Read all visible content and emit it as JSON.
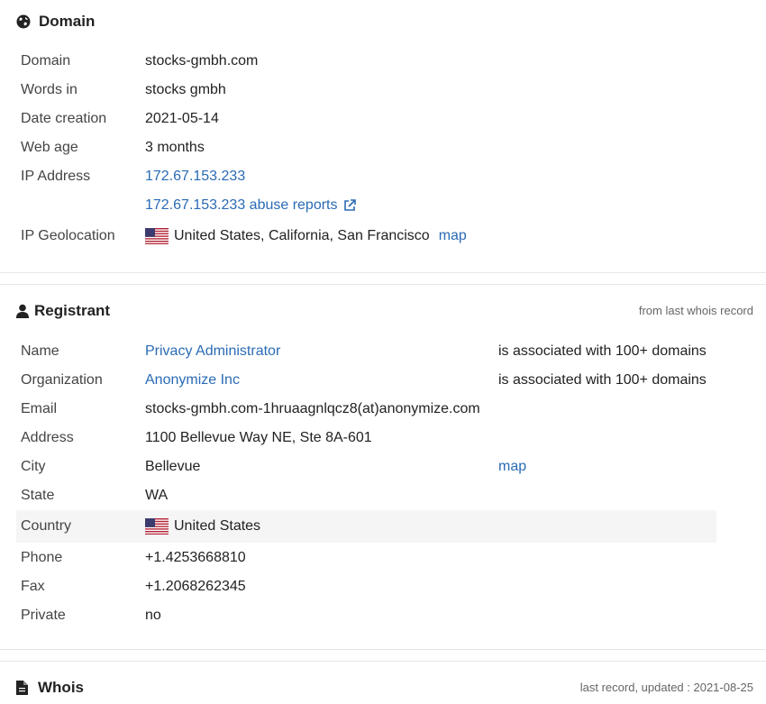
{
  "domain_section": {
    "title": "Domain",
    "icon": "globe-icon",
    "rows": {
      "domain": {
        "label": "Domain",
        "value": "stocks-gmbh.com"
      },
      "words": {
        "label": "Words in",
        "value": "stocks gmbh"
      },
      "created": {
        "label": "Date creation",
        "value": "2021-05-14"
      },
      "age": {
        "label": "Web age",
        "value": "3 months"
      },
      "ip": {
        "label": "IP Address",
        "value": "172.67.153.233"
      },
      "abuse": {
        "value": "172.67.153.233 abuse reports"
      },
      "geo": {
        "label": "IP Geolocation",
        "value": "United States, California, San Francisco",
        "map": "map"
      }
    }
  },
  "registrant_section": {
    "title": "Registrant",
    "icon": "user-icon",
    "note": "from last whois record",
    "rows": {
      "name": {
        "label": "Name",
        "value": "Privacy Administrator",
        "assoc": "is associated with 100+ domains"
      },
      "org": {
        "label": "Organization",
        "value": "Anonymize Inc",
        "assoc": "is associated with 100+ domains"
      },
      "email": {
        "label": "Email",
        "value": "stocks-gmbh.com-1hruaagnlqcz8(at)anonymize.com"
      },
      "address": {
        "label": "Address",
        "value": "1100 Bellevue Way NE, Ste 8A-601"
      },
      "city": {
        "label": "City",
        "value": "Bellevue",
        "map": "map"
      },
      "state": {
        "label": "State",
        "value": "WA"
      },
      "country": {
        "label": "Country",
        "value": "United States"
      },
      "phone": {
        "label": "Phone",
        "value": "+1.4253668810"
      },
      "fax": {
        "label": "Fax",
        "value": "+1.2068262345"
      },
      "private": {
        "label": "Private",
        "value": "no"
      }
    }
  },
  "whois_section": {
    "title": "Whois",
    "icon": "document-icon",
    "note": "last record, updated : 2021-08-25"
  },
  "colors": {
    "link": "#2a6bb5",
    "text": "#222222",
    "label": "#444444",
    "note": "#666666",
    "highlight": "#f5f5f5"
  }
}
